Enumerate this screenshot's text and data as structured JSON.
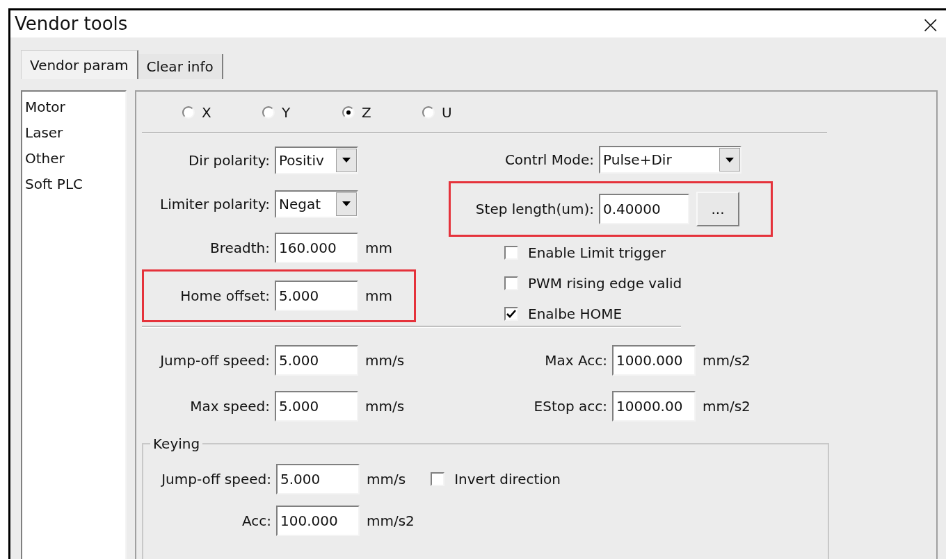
{
  "window": {
    "title": "Vendor tools",
    "close": "×"
  },
  "tabs": [
    {
      "label": "Vendor param",
      "selected": true
    },
    {
      "label": "Clear info",
      "selected": false
    }
  ],
  "sidebar": {
    "items": [
      {
        "label": "Motor"
      },
      {
        "label": "Laser"
      },
      {
        "label": "Other"
      },
      {
        "label": "Soft PLC"
      }
    ]
  },
  "axes": [
    {
      "label": "X",
      "selected": false
    },
    {
      "label": "Y",
      "selected": false
    },
    {
      "label": "Z",
      "selected": true
    },
    {
      "label": "U",
      "selected": false
    }
  ],
  "left_fields": [
    {
      "kind": "dropdown",
      "label": "Dir polarity:",
      "value": "Positiv",
      "highlighted": false
    },
    {
      "kind": "dropdown",
      "label": "Limiter polarity:",
      "value": "Negat",
      "highlighted": false
    },
    {
      "kind": "input",
      "label": "Breadth:",
      "value": "160.000",
      "unit": "mm",
      "highlighted": false
    },
    {
      "kind": "input",
      "label": "Home offset:",
      "value": "5.000",
      "unit": "mm",
      "highlighted": true
    }
  ],
  "right_fields": [
    {
      "kind": "dropdown",
      "label": "Contrl Mode:",
      "value": "Pulse+Dir",
      "highlighted": false
    },
    {
      "kind": "input_button",
      "label": "Step length(um):",
      "value": "0.40000",
      "button": "...",
      "highlighted": true
    }
  ],
  "options": [
    {
      "label": "Enable Limit trigger",
      "checked": false
    },
    {
      "label": "PWM rising edge valid",
      "checked": false
    },
    {
      "label": "Enalbe HOME",
      "checked": true
    }
  ],
  "speed_rows": [
    {
      "left": {
        "label": "Jump-off speed:",
        "value": "5.000",
        "unit": "mm/s"
      },
      "right": {
        "label": "Max Acc:",
        "value": "1000.000",
        "unit": "mm/s2"
      }
    },
    {
      "left": {
        "label": "Max speed:",
        "value": "5.000",
        "unit": "mm/s"
      },
      "right": {
        "label": "EStop acc:",
        "value": "10000.00",
        "unit": "mm/s2"
      }
    }
  ],
  "keying": {
    "title": "Keying",
    "fields": [
      {
        "label": "Jump-off speed:",
        "value": "5.000",
        "unit": "mm/s"
      },
      {
        "label": "Acc:",
        "value": "100.000",
        "unit": "mm/s2"
      }
    ],
    "option": {
      "label": "Invert direction",
      "checked": false
    }
  }
}
